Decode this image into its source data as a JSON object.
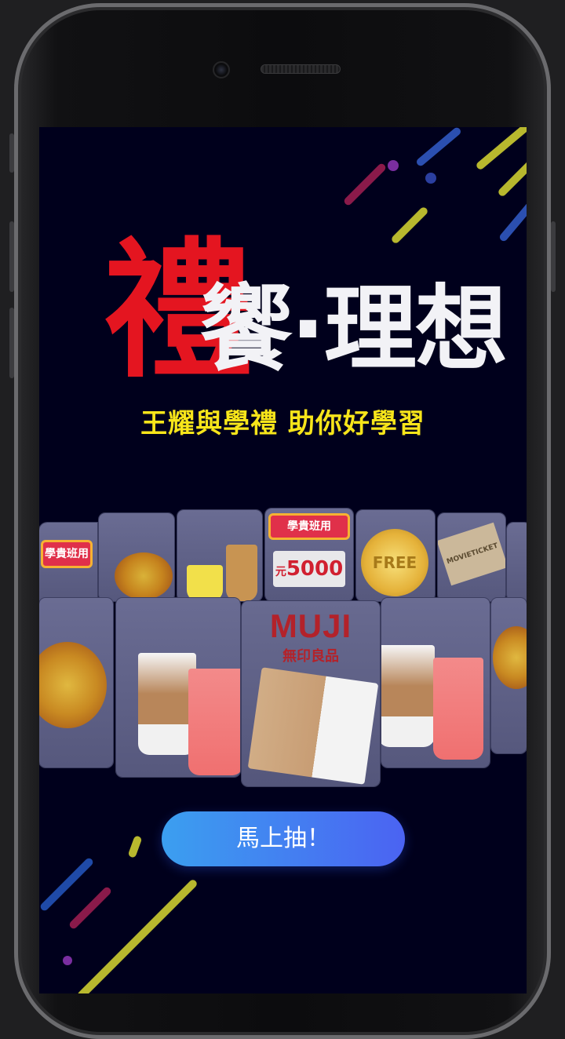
{
  "title": {
    "big_char": "禮",
    "rest": "饗·理想"
  },
  "subtitle": "王耀與學禮 助你好學習",
  "cards": {
    "coupon_sign": "學貴班用",
    "voucher_value": "5000",
    "voucher_unit": "元",
    "coin_text": "FREE",
    "ticket_text": "MOVIETICKET",
    "muji_logo": "MUJI",
    "muji_sub": "無印良品"
  },
  "cta": {
    "label": "馬上抽！"
  },
  "colors": {
    "background": "#00001c",
    "title_red": "#e41520",
    "subtitle_yellow": "#f7e51a",
    "cta_start": "#3b9ff0",
    "cta_end": "#4b63f2"
  }
}
